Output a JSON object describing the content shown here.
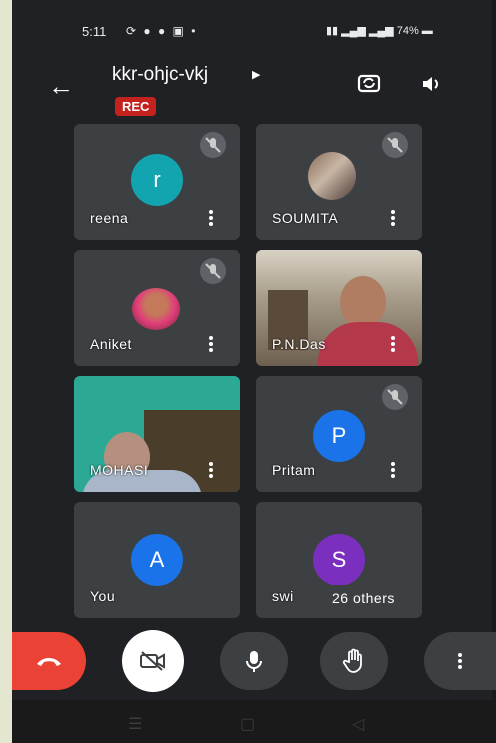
{
  "status": {
    "time": "5:11",
    "battery": "74%"
  },
  "meeting": {
    "code": "kkr-ohjc-vkj",
    "rec_badge": "REC"
  },
  "participants": [
    {
      "name": "reena",
      "initial": "r",
      "avatar_color": "#12a4af",
      "muted": true
    },
    {
      "name": "SOUMITA",
      "muted": true
    },
    {
      "name": "Aniket",
      "muted": true
    },
    {
      "name": "P.N.Das",
      "muted": false
    },
    {
      "name": "MOHASI",
      "muted": false
    },
    {
      "name": "Pritam",
      "initial": "P",
      "avatar_color": "#1a73e8",
      "muted": true
    },
    {
      "name": "You",
      "initial": "A",
      "avatar_color": "#1a73e8",
      "muted": false
    },
    {
      "name": "swi",
      "initial": "S",
      "avatar_color": "#7b2fbf",
      "muted": false
    }
  ],
  "others_chip": "26 others",
  "colors": {
    "end_call": "#ea4335",
    "tile": "#3c4043",
    "background": "#202124",
    "rec": "#c5221f"
  },
  "icons": {
    "back": "arrow-left-icon",
    "switch_camera": "switch-camera-icon",
    "speaker": "speaker-icon",
    "end_call": "phone-hangup-icon",
    "camera_off": "camera-off-icon",
    "mic": "microphone-icon",
    "raise_hand": "raise-hand-icon",
    "more": "more-vert-icon"
  }
}
